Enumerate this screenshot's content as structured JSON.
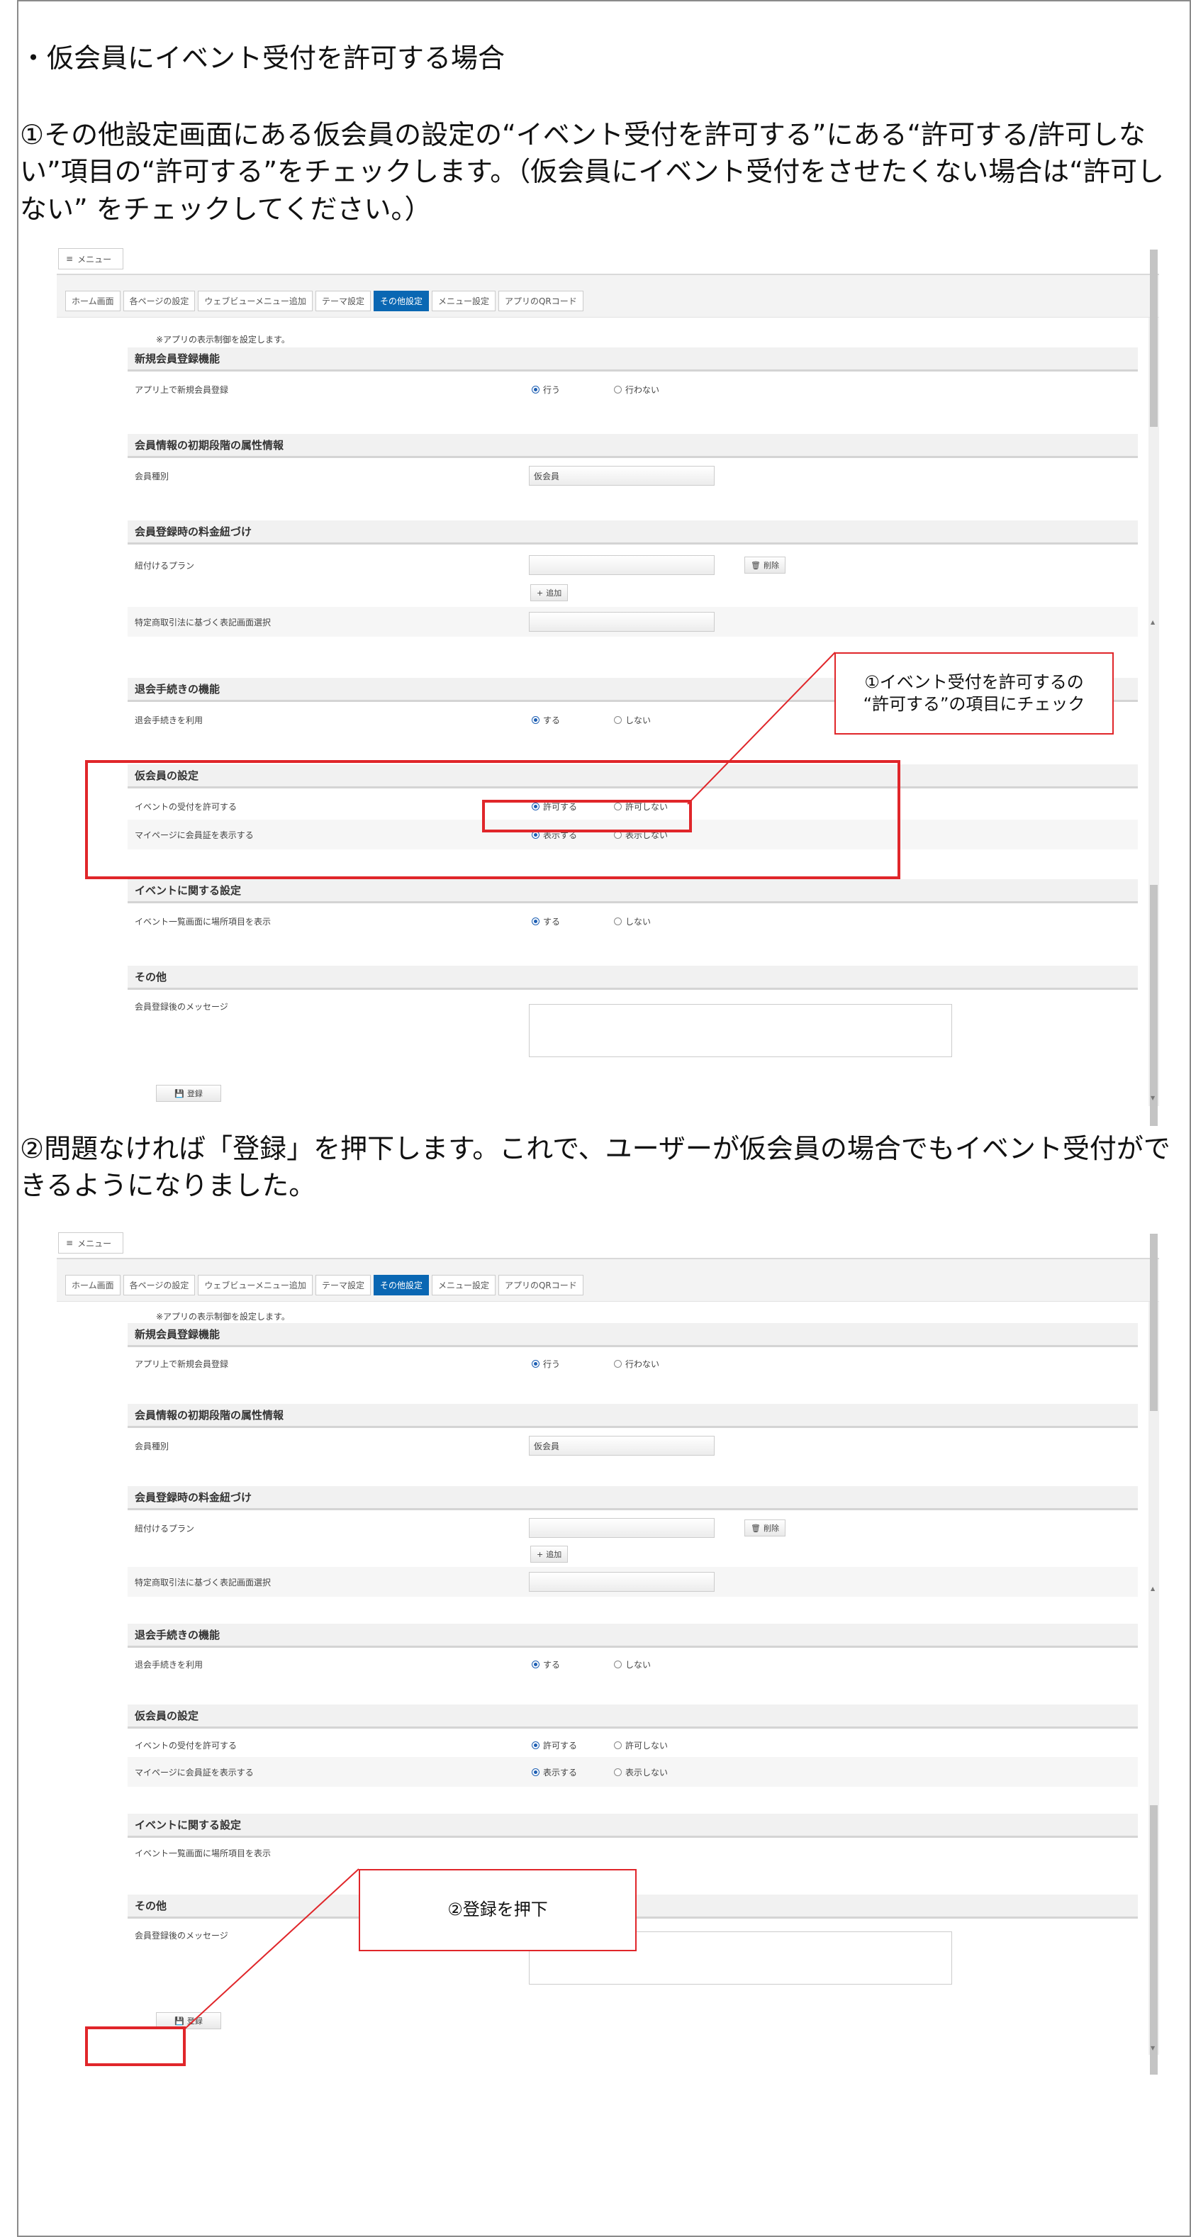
{
  "section_heading": "・仮会員にイベント受付を許可する場合",
  "step1_text": "①その他設定画面にある仮会員の設定の“イベント受付を許可する”にある“許可する/許可しない”項目の“許可する”をチェックします。（仮会員にイベント受付をさせたくない場合は“許可しない” をチェックしてください。）",
  "step2_text": "②問題なければ「登録」を押下します。これで、ユーザーが仮会員の場合でもイベント受付ができるようになりました。",
  "callout1": "①イベント受付を許可するの\n“許可する”の項目にチェック",
  "callout2": "②登録を押下",
  "screens": [
    {
      "menu_label": "メニュー",
      "tabs": [
        "ホーム画面",
        "各ページの設定",
        "ウェブビューメニュー追加",
        "テーマ設定",
        "その他設定",
        "メニュー設定",
        "アプリのQRコード"
      ],
      "active_tab": "その他設定",
      "note": "※アプリの表示制御を設定します。",
      "sections": {
        "new_member": {
          "title": "新規会員登録機能",
          "label": "アプリ上で新規会員登録",
          "opt_yes": "行う",
          "opt_no": "行わない"
        },
        "initial_attr": {
          "title": "会員情報の初期段階の属性情報",
          "label": "会員種別",
          "select_value": "仮会員"
        },
        "fee_link": {
          "title": "会員登録時の料金紐づけ",
          "label": "紐付けるプラン",
          "delete_label": "削除",
          "add_label": "追加",
          "law_label": "特定商取引法に基づく表記画面選択"
        },
        "withdraw": {
          "title": "退会手続きの機能",
          "label": "退会手続きを利用",
          "opt_yes": "する",
          "opt_no": "しない"
        },
        "temp_member": {
          "title": "仮会員の設定",
          "event_label": "イベントの受付を許可する",
          "event_yes": "許可する",
          "event_no": "許可しない",
          "card_label": "マイページに会員証を表示する",
          "card_yes": "表示する",
          "card_no": "表示しない"
        },
        "event": {
          "title": "イベントに関する設定",
          "label": "イベント一覧画面に場所項目を表示",
          "opt_yes": "する",
          "opt_no": "しない"
        },
        "other": {
          "title": "その他",
          "label": "会員登録後のメッセージ"
        }
      },
      "register_label": "登録"
    }
  ],
  "colors": {
    "accent_tab": "#0a67b3",
    "highlight": "#e0262a"
  }
}
